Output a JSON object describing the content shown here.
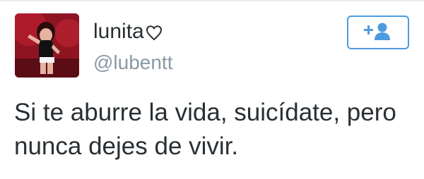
{
  "user": {
    "display_name": "lunita",
    "name_suffix_icon": "heart-outline-icon",
    "handle": "@lubentt"
  },
  "follow_button": {
    "icon": "add-user-icon",
    "accent_color": "#4d9be0"
  },
  "tweet": {
    "lines": [
      "Si te aburre la vida, suicídate, pero",
      "nunca dejes de vivir."
    ]
  },
  "colors": {
    "text": "#292f33",
    "handle": "#8899a6",
    "accent": "#4d9be0"
  }
}
